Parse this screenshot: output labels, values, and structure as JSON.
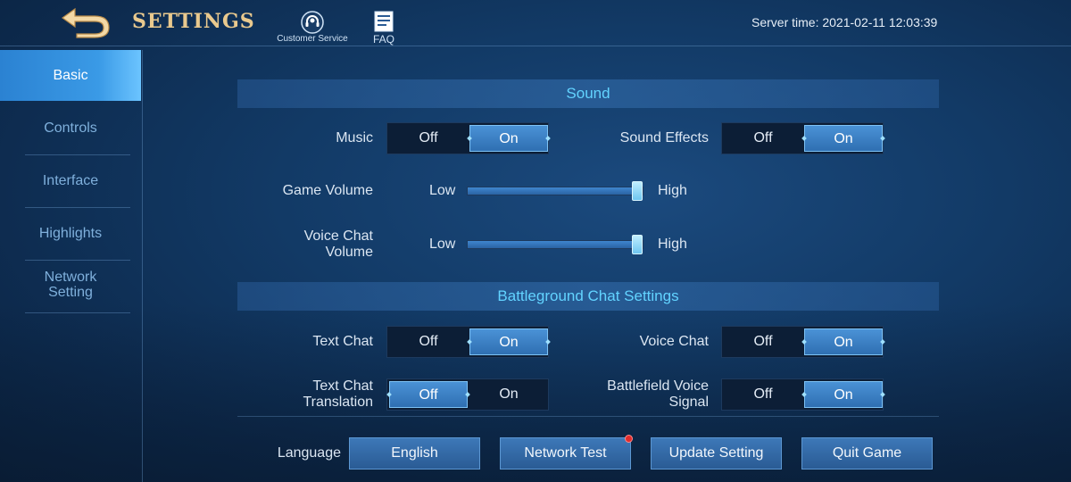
{
  "header": {
    "title": "SETTINGS",
    "customer_service_label": "Customer Service",
    "faq_label": "FAQ",
    "server_time": "Server time: 2021-02-11 12:03:39"
  },
  "sidebar": {
    "items": [
      {
        "label": "Basic",
        "active": true
      },
      {
        "label": "Controls",
        "active": false
      },
      {
        "label": "Interface",
        "active": false
      },
      {
        "label": "Highlights",
        "active": false
      },
      {
        "label": "Network Setting",
        "active": false
      }
    ]
  },
  "sections": {
    "sound": "Sound",
    "battleground_chat": "Battleground Chat Settings"
  },
  "toggles": {
    "off_label": "Off",
    "on_label": "On",
    "music": {
      "label": "Music",
      "value": "On"
    },
    "sound_effects": {
      "label": "Sound Effects",
      "value": "On"
    },
    "text_chat": {
      "label": "Text Chat",
      "value": "On"
    },
    "voice_chat": {
      "label": "Voice Chat",
      "value": "On"
    },
    "text_chat_translation": {
      "label": "Text Chat Translation",
      "value": "Off"
    },
    "battlefield_voice_signal": {
      "label": "Battlefield Voice Signal",
      "value": "On"
    }
  },
  "sliders": {
    "low_label": "Low",
    "high_label": "High",
    "game_volume": {
      "label": "Game Volume",
      "level": 1.0
    },
    "voice_chat_volume": {
      "label": "Voice Chat Volume",
      "level": 1.0
    }
  },
  "footer": {
    "language_label": "Language",
    "language_value": "English",
    "network_test": "Network Test",
    "update_setting": "Update Setting",
    "quit_game": "Quit Game",
    "network_test_notification": true
  },
  "colors": {
    "accent": "#62d3ff",
    "title_gold": "#e9c98e",
    "selected_toggle": "#3f86cf",
    "notification": "#e02b2b"
  }
}
